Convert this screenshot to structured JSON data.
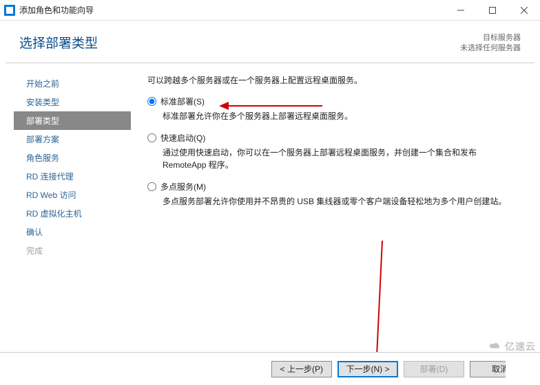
{
  "window": {
    "title": "添加角色和功能向导"
  },
  "header": {
    "heading": "选择部署类型",
    "target_label": "目标服务器",
    "target_value": "未选择任何服务器"
  },
  "nav": {
    "items": [
      {
        "label": "开始之前",
        "state": "completed"
      },
      {
        "label": "安装类型",
        "state": "completed"
      },
      {
        "label": "部署类型",
        "state": "active"
      },
      {
        "label": "部署方案",
        "state": "completed"
      },
      {
        "label": "角色服务",
        "state": "completed"
      },
      {
        "label": "RD 连接代理",
        "state": "completed"
      },
      {
        "label": "RD Web 访问",
        "state": "completed"
      },
      {
        "label": "RD 虚拟化主机",
        "state": "completed"
      },
      {
        "label": "确认",
        "state": "completed"
      },
      {
        "label": "完成",
        "state": "disabled"
      }
    ]
  },
  "content": {
    "intro": "可以跨越多个服务器或在一个服务器上配置远程桌面服务。",
    "options": [
      {
        "id": "standard",
        "label": "标准部署(S)",
        "desc": "标准部署允许你在多个服务器上部署远程桌面服务。",
        "selected": true
      },
      {
        "id": "quick",
        "label": "快速启动(Q)",
        "desc": "通过使用快速启动，你可以在一个服务器上部署远程桌面服务，并创建一个集合和发布 RemoteApp 程序。",
        "selected": false
      },
      {
        "id": "multipoint",
        "label": "多点服务(M)",
        "desc": "多点服务部署允许你使用并不昂贵的 USB 集线器或零个客户端设备轻松地为多个用户创建站。",
        "selected": false
      }
    ]
  },
  "footer": {
    "prev": "< 上一步(P)",
    "next": "下一步(N) >",
    "deploy": "部署(D)",
    "cancel": "取消"
  },
  "watermark": "亿速云"
}
